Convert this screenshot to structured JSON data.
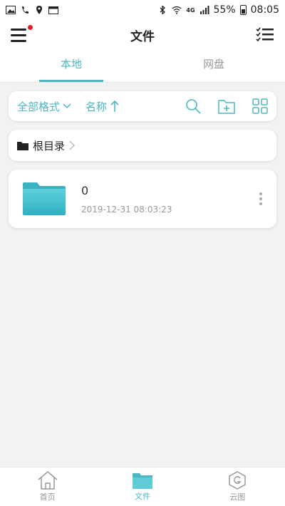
{
  "status": {
    "signal_label": "4G",
    "battery": "55%",
    "time": "08:05"
  },
  "header": {
    "title": "文件"
  },
  "tabs": [
    {
      "label": "本地"
    },
    {
      "label": "网盘"
    }
  ],
  "toolbar": {
    "format_label": "全部格式",
    "sort_label": "名称"
  },
  "breadcrumb": {
    "root_label": "根目录"
  },
  "files": [
    {
      "name": "0",
      "time": "2019-12-31 08:03:23"
    }
  ],
  "nav": [
    {
      "label": "首页"
    },
    {
      "label": "文件"
    },
    {
      "label": "云图"
    }
  ],
  "colors": {
    "accent": "#4ab7c2",
    "notification_dot": "#e02020",
    "folder": "#3fbccb"
  }
}
